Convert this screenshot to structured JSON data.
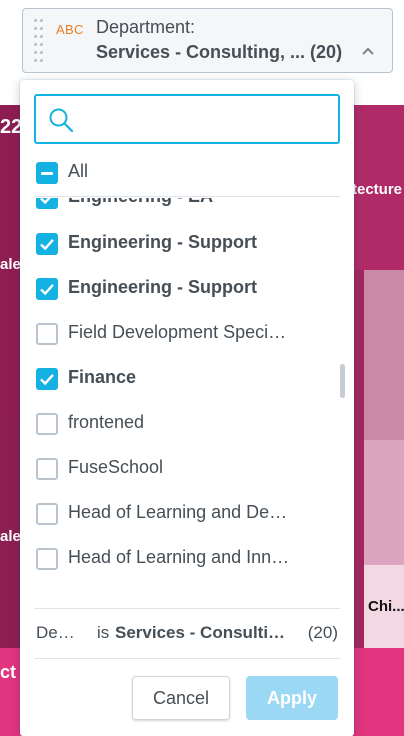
{
  "background": {
    "tile_labels": [
      "22",
      "ale",
      "ale",
      "ct",
      "tecture",
      "Chi..."
    ]
  },
  "filter": {
    "type_badge": "ABC",
    "title": "Department:",
    "selected_value": "Services - Consulting, ... (20)"
  },
  "dropdown": {
    "search": {
      "placeholder": "",
      "value": ""
    },
    "all_label": "All",
    "items": [
      {
        "label": "Engineering - EA",
        "checked": true
      },
      {
        "label": "Engineering - Support",
        "checked": true
      },
      {
        "label": "Engineering - Support",
        "checked": true
      },
      {
        "label": "Field Development Speci…",
        "checked": false
      },
      {
        "label": "Finance",
        "checked": true
      },
      {
        "label": "frontened",
        "checked": false
      },
      {
        "label": "FuseSchool",
        "checked": false
      },
      {
        "label": "Head of Learning and De…",
        "checked": false
      },
      {
        "label": "Head of Learning and Inn…",
        "checked": false
      }
    ],
    "status": {
      "attribute": "De…",
      "operator": "is",
      "value": "Services - Consulti…",
      "count": "(20)"
    },
    "cancel_label": "Cancel",
    "apply_label": "Apply"
  },
  "colors": {
    "accent": "#14b2e2",
    "apply_disabled": "#9ad8f3",
    "badge_orange": "#e87e24",
    "text": "#464e56"
  }
}
